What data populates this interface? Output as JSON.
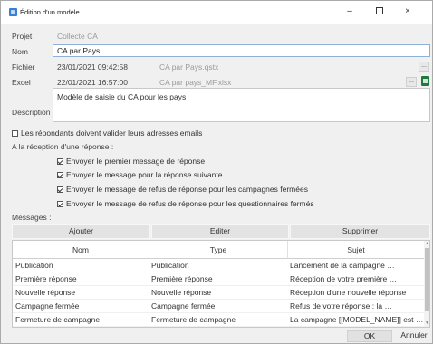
{
  "window": {
    "title": "Édition d'un modèle",
    "minimize": "–",
    "close": "×"
  },
  "form": {
    "projet_label": "Projet",
    "projet_value": "Collecte CA",
    "nom_label": "Nom",
    "nom_value": "CA par Pays",
    "fichier_label": "Fichier",
    "fichier_date": "23/01/2021 09:42:58",
    "fichier_name": "CA par Pays.qstx",
    "excel_label": "Excel",
    "excel_date": "22/01/2021 16:57:00",
    "excel_name": "CA par pays_MF.xlsx",
    "browse_label": "...",
    "description_label": "Description",
    "description_value": "Modèle de saisie du CA pour les pays"
  },
  "options": {
    "validate_emails": {
      "label": "Les répondants doivent valider leurs adresses emails",
      "checked": false
    },
    "on_reception_label": "A la réception d'une réponse :",
    "send_first": {
      "label": "Envoyer le premier message de réponse",
      "checked": true
    },
    "send_next": {
      "label": "Envoyer le message pour la réponse suivante",
      "checked": true
    },
    "send_refusal_closed_campaigns": {
      "label": "Envoyer le message de refus de réponse pour les campagnes fermées",
      "checked": true
    },
    "send_refusal_closed_questionnaires": {
      "label": "Envoyer le message de refus de réponse pour les questionnaires fermés",
      "checked": true
    }
  },
  "messages": {
    "label": "Messages :",
    "add_label": "Ajouter",
    "edit_label": "Editer",
    "delete_label": "Supprimer",
    "columns": [
      "Nom",
      "Type",
      "Sujet"
    ],
    "rows": [
      [
        "Publication",
        "Publication",
        "Lancement de la campagne …"
      ],
      [
        "Première réponse",
        "Première réponse",
        "Réception de votre première …"
      ],
      [
        "Nouvelle réponse",
        "Nouvelle réponse",
        "Réception d'une nouvelle réponse"
      ],
      [
        "Campagne fermée",
        "Campagne fermée",
        "Refus de votre réponse : la …"
      ],
      [
        "Fermeture de campagne",
        "Fermeture de campagne",
        "La campagne [[MODEL_NAME]] est …"
      ]
    ]
  },
  "footer": {
    "ok_label": "OK",
    "cancel_label": "Annuler"
  },
  "colors": {
    "accent": "#3b7fd1",
    "excel": "#1f7a3f"
  }
}
